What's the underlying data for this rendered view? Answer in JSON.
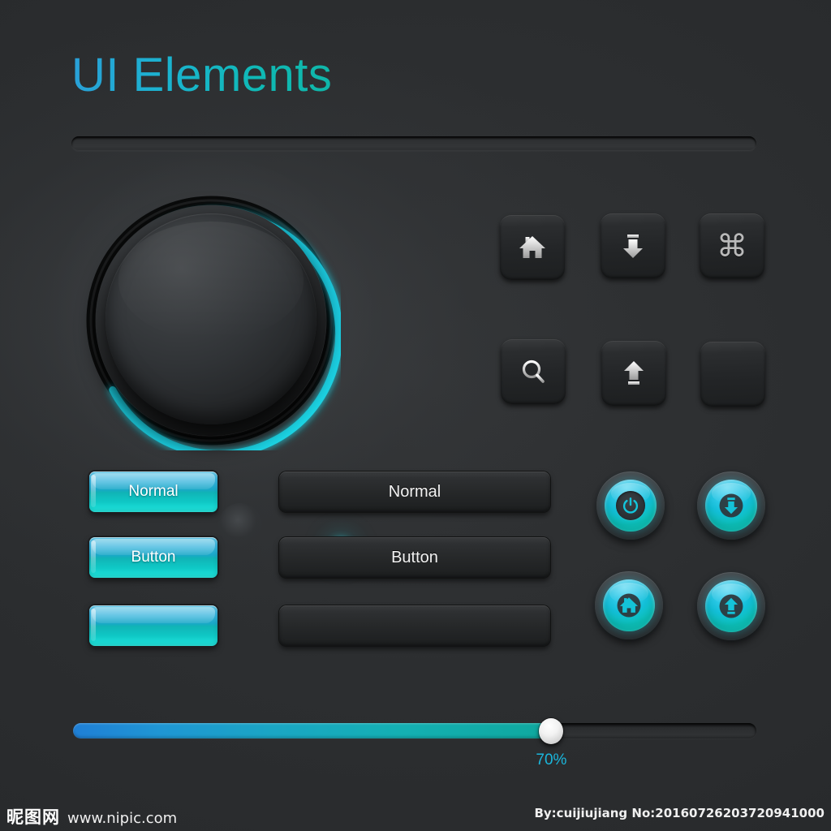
{
  "page": {
    "title": "UI Elements",
    "background_color": "#2c2e30",
    "accent_color": "#1ab7dd",
    "accent_color_2": "#0fc9c6"
  },
  "top_track": {
    "name": "empty-progress-track",
    "value": 0
  },
  "knob": {
    "name": "rotary-knob",
    "arc_color": "#1fd4e3",
    "indicator_color": "#2fd7e6",
    "arc_start_deg": 35,
    "arc_end_deg": 215
  },
  "icon_buttons": [
    {
      "icon": "home-icon",
      "label": ""
    },
    {
      "icon": "download-icon",
      "label": ""
    },
    {
      "icon": "command-icon",
      "label": "⌘"
    },
    {
      "icon": "search-icon",
      "label": ""
    },
    {
      "icon": "upload-icon",
      "label": ""
    },
    {
      "icon": "blank-icon",
      "label": ""
    }
  ],
  "teal_buttons": [
    {
      "label": "Normal"
    },
    {
      "label": "Button"
    },
    {
      "label": ""
    }
  ],
  "dark_buttons": [
    {
      "label": "Normal"
    },
    {
      "label": "Button"
    },
    {
      "label": ""
    }
  ],
  "round_buttons": [
    {
      "icon": "power-icon"
    },
    {
      "icon": "download-icon"
    },
    {
      "icon": "home-icon"
    },
    {
      "icon": "upload-icon"
    }
  ],
  "slider": {
    "name": "progress-slider",
    "value": 70,
    "value_label": "70%",
    "min": 0,
    "max": 100,
    "fill_start_color": "#1f7fd6",
    "fill_end_color": "#0fa89e"
  },
  "footer": {
    "site_name": "昵图网",
    "site_url": "www.nipic.com",
    "credit": "By:cuijiujiang No:20160726203720941000"
  }
}
